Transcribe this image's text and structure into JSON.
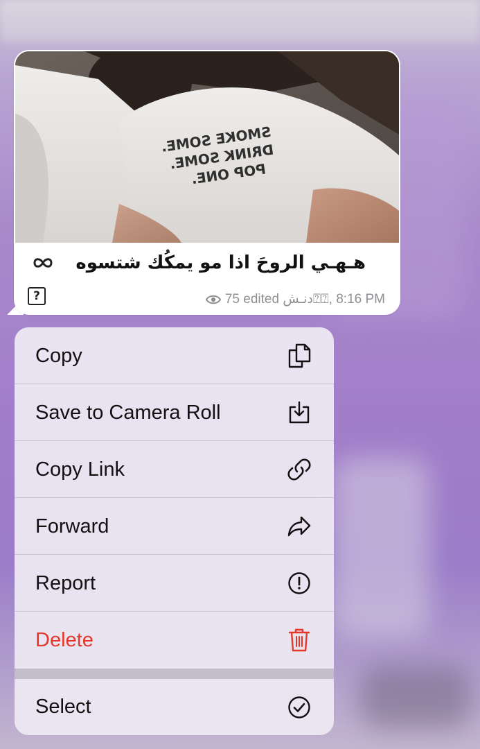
{
  "message": {
    "caption": "هـهـي الروحَ اذا مو يمكُك شتسوه",
    "meta_text": "75 edited دنـش⍰⍰, 8:16 PM",
    "unknown_glyph": "?",
    "shirt_text": "SMOKE SOME. DRINK SOME. POP ONE."
  },
  "menu": {
    "items": [
      {
        "label": "Copy",
        "icon": "copy-icon"
      },
      {
        "label": "Save to Camera Roll",
        "icon": "save-icon"
      },
      {
        "label": "Copy Link",
        "icon": "link-icon"
      },
      {
        "label": "Forward",
        "icon": "forward-icon"
      },
      {
        "label": "Report",
        "icon": "report-icon"
      },
      {
        "label": "Delete",
        "icon": "trash-icon",
        "color": "#e5362b"
      },
      {
        "label": "Select",
        "icon": "checkmark-circle-icon"
      }
    ]
  },
  "colors": {
    "background": "#a27ec9",
    "bubble": "#ffffff",
    "menu": "#ece7f2",
    "destructive": "#e5362b",
    "meta_text": "#8e8e93"
  }
}
